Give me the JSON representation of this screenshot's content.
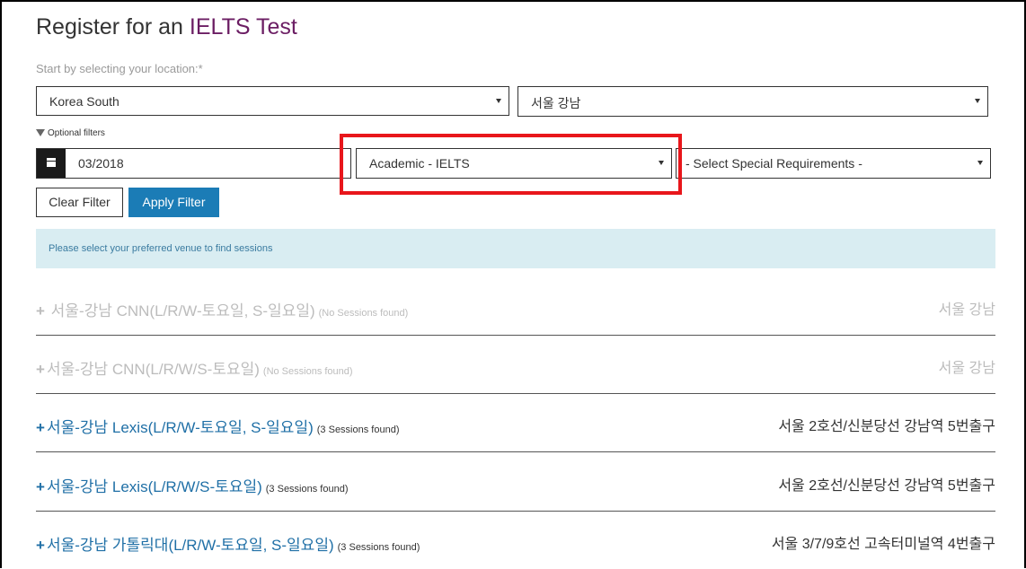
{
  "page": {
    "title_prefix": "Register for an",
    "title_accent": "IELTS Test",
    "location_label": "Start by selecting your location:*"
  },
  "location": {
    "country": "Korea South",
    "city": "서울 강남"
  },
  "filters": {
    "optional_label": "Optional filters",
    "date": "03/2018",
    "test_type": "Academic - IELTS",
    "special_requirements": "- Select Special Requirements -",
    "clear_label": "Clear Filter",
    "apply_label": "Apply Filter"
  },
  "info_message": "Please select your preferred venue to find sessions",
  "venues": [
    {
      "name": "서울-강남 CNN(L/R/W-토요일, S-일요일)",
      "count": "(No Sessions found)",
      "area": "서울 강남"
    },
    {
      "name": "서울-강남 CNN(L/R/W/S-토요일)",
      "count": "(No Sessions found)",
      "area": "서울 강남"
    },
    {
      "name": "서울-강남 Lexis(L/R/W-토요일, S-일요일)",
      "count": "(3 Sessions found)",
      "area": "서울 2호선/신분당선 강남역 5번출구"
    },
    {
      "name": "서울-강남 Lexis(L/R/W/S-토요일)",
      "count": "(3 Sessions found)",
      "area": "서울 2호선/신분당선 강남역 5번출구"
    },
    {
      "name": "서울-강남 가톨릭대(L/R/W-토요일, S-일요일)",
      "count": "(3 Sessions found)",
      "area": "서울 3/7/9호선 고속터미널역 4번출구"
    }
  ],
  "colors": {
    "accent": "#6b1d63",
    "link": "#1f6fa6",
    "primary_button": "#1b7cb6",
    "info_bg": "#d9edf2",
    "highlight": "#e8161b"
  }
}
